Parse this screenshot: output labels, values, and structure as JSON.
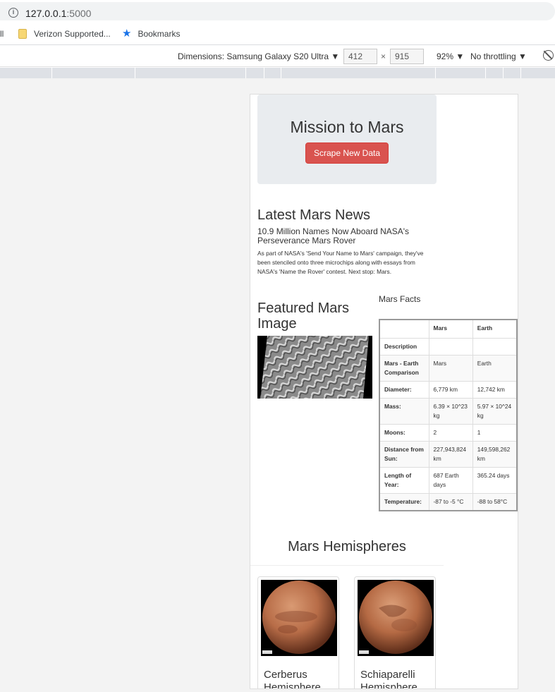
{
  "browser": {
    "url_host": "127.0.0.1",
    "url_port": ":5000",
    "bookmarks": [
      {
        "label": "ll"
      },
      {
        "label": "Verizon Supported..."
      },
      {
        "label": "Bookmarks"
      }
    ]
  },
  "devtools": {
    "dimensions_label": "Dimensions: Samsung Galaxy S20 Ultra ▼",
    "width": "412",
    "height": "915",
    "times": "×",
    "zoom": "92% ▼",
    "throttling": "No throttling ▼"
  },
  "page": {
    "title": "Mission to Mars",
    "scrape_button": "Scrape New Data",
    "news_heading": "Latest Mars News",
    "news_title": "10.9 Million Names Now Aboard NASA's Perseverance Mars Rover",
    "news_paragraph": "As part of NASA's 'Send Your Name to Mars' campaign, they've been stenciled onto three microchips along with essays from NASA's 'Name the Rover' contest. Next stop: Mars.",
    "featured_heading": "Featured Mars Image",
    "facts_heading": "Mars Facts",
    "facts_table": {
      "col_mars": "Mars",
      "col_earth": "Earth",
      "rows": [
        {
          "label": "Description",
          "mars": "",
          "earth": ""
        },
        {
          "label": "Mars - Earth Comparison",
          "mars": "Mars",
          "earth": "Earth"
        },
        {
          "label": "Diameter:",
          "mars": "6,779 km",
          "earth": "12,742 km"
        },
        {
          "label": "Mass:",
          "mars": "6.39 × 10^23 kg",
          "earth": "5.97 × 10^24 kg"
        },
        {
          "label": "Moons:",
          "mars": "2",
          "earth": "1"
        },
        {
          "label": "Distance from Sun:",
          "mars": "227,943,824 km",
          "earth": "149,598,262 km"
        },
        {
          "label": "Length of Year:",
          "mars": "687 Earth days",
          "earth": "365.24 days"
        },
        {
          "label": "Temperature:",
          "mars": "-87 to -5 °C",
          "earth": "-88 to 58°C"
        }
      ]
    },
    "hemispheres_heading": "Mars Hemispheres",
    "hemispheres": [
      {
        "title": "Cerberus Hemisphere"
      },
      {
        "title": "Schiaparelli Hemisphere"
      }
    ]
  },
  "colors": {
    "scrape_button": "#d9534f",
    "jumbotron": "#e9ecef",
    "bookmark_star": "#1a73e8"
  }
}
